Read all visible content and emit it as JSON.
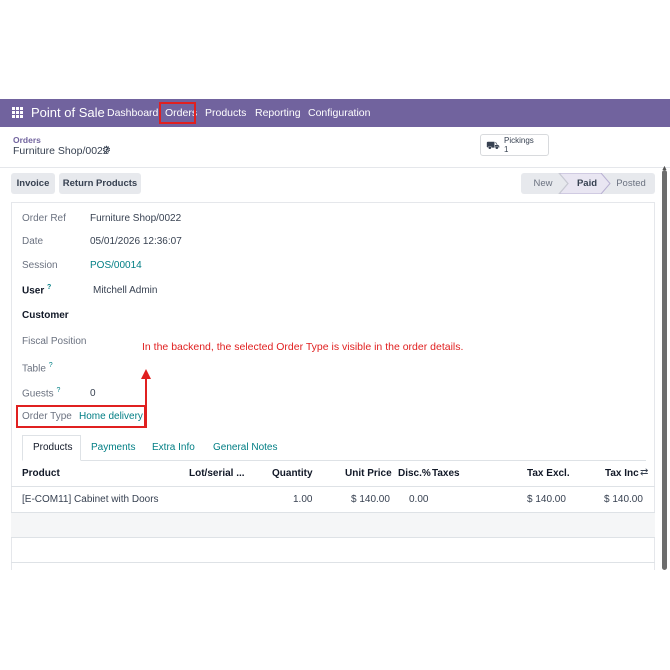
{
  "navbar": {
    "brand": "Point of Sale",
    "items": [
      "Dashboard",
      "Orders",
      "Products",
      "Reporting",
      "Configuration"
    ]
  },
  "breadcrumb": {
    "parent": "Orders",
    "current": "Furniture Shop/0022"
  },
  "smart_button": {
    "label": "Pickings",
    "count": "1"
  },
  "actions": {
    "invoice": "Invoice",
    "return_products": "Return Products"
  },
  "status": {
    "steps": [
      "New",
      "Paid",
      "Posted"
    ],
    "active": "Paid"
  },
  "form": {
    "order_ref_label": "Order Ref",
    "order_ref": "Furniture Shop/0022",
    "date_label": "Date",
    "date": "05/01/2026 12:36:07",
    "session_label": "Session",
    "session": "POS/00014",
    "user_label": "User",
    "user": "Mitchell Admin",
    "customer_label": "Customer",
    "fiscal_position_label": "Fiscal Position",
    "table_label": "Table",
    "guests_label": "Guests",
    "guests": "0",
    "order_type_label": "Order Type",
    "order_type": "Home delivery",
    "help_mark": "?"
  },
  "annotation": "In the backend, the selected Order Type is visible in the order details.",
  "tabs": [
    "Products",
    "Payments",
    "Extra Info",
    "General Notes"
  ],
  "table": {
    "headers": [
      "Product",
      "Lot/serial ...",
      "Quantity",
      "Unit Price",
      "Disc.%",
      "Taxes",
      "Tax Excl.",
      "Tax Inc"
    ],
    "rows": [
      [
        "[E-COM11] Cabinet with Doors",
        "",
        "1.00",
        "$ 140.00",
        "0.00",
        "",
        "$ 140.00",
        "$ 140.00"
      ]
    ]
  },
  "colors": {
    "brand": "#71639e",
    "link": "#017e84",
    "highlight": "#e02020"
  },
  "icons": {
    "apps": "apps-grid-icon",
    "gear": "gear-icon",
    "truck": "truck-icon",
    "column_toggle": "column-toggle-icon"
  }
}
